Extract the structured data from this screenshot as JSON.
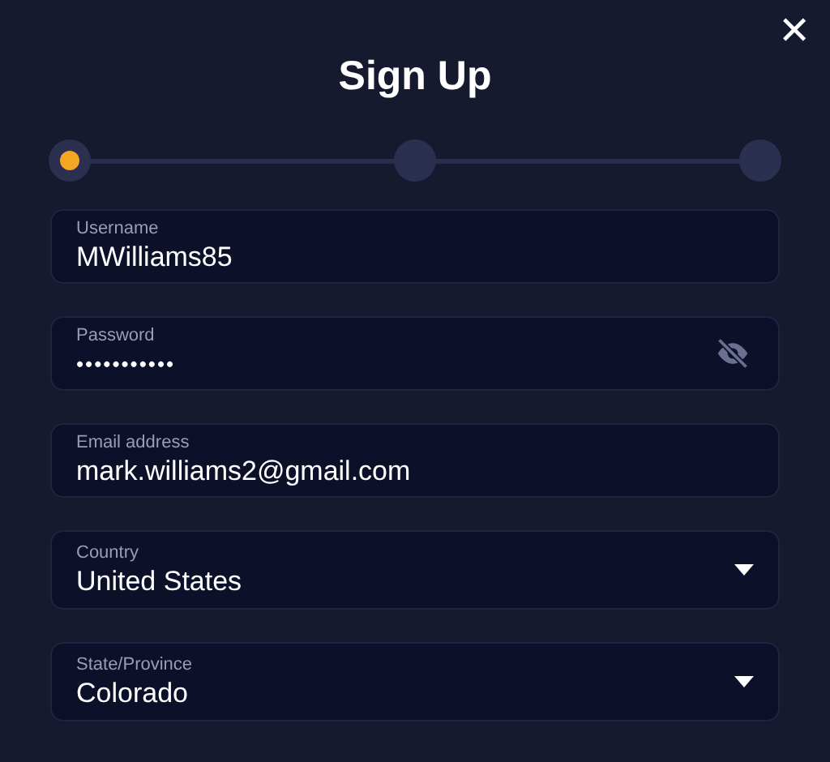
{
  "dialog": {
    "title": "Sign Up",
    "close": "✕"
  },
  "steps": [
    {
      "active": true
    },
    {
      "active": false
    },
    {
      "active": false
    }
  ],
  "fields": [
    {
      "kind": "text",
      "label": "Username",
      "value": "MWilliams85"
    },
    {
      "kind": "password",
      "label": "Password",
      "value": "•••••••••••"
    },
    {
      "kind": "text",
      "label": "Email address",
      "value": "mark.williams2@gmail.com"
    },
    {
      "kind": "select",
      "label": "Country",
      "value": "United States"
    },
    {
      "kind": "select",
      "label": "State/Province",
      "value": "Colorado"
    }
  ]
}
